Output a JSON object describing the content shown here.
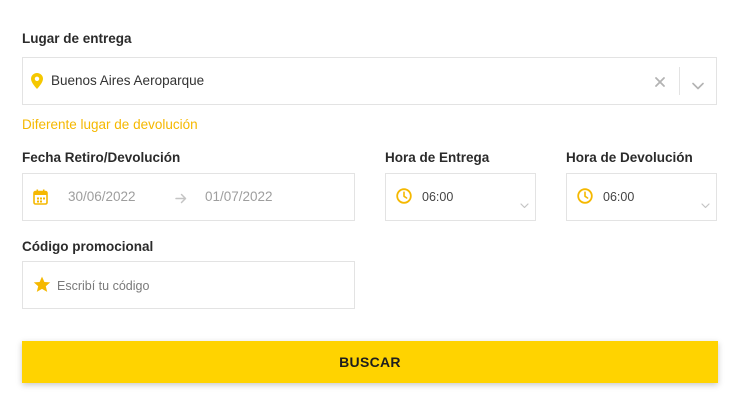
{
  "pickup": {
    "label": "Lugar de entrega",
    "value": "Buenos Aires Aeroparque",
    "different_return_link": "Diferente lugar de devolución"
  },
  "dates": {
    "label": "Fecha Retiro/Devolución",
    "start": "30/06/2022",
    "end": "01/07/2022"
  },
  "pickup_time": {
    "label": "Hora de Entrega",
    "value": "06:00"
  },
  "return_time": {
    "label": "Hora de Devolución",
    "value": "06:00"
  },
  "promo": {
    "label": "Código promocional",
    "placeholder": "Escribí tu código"
  },
  "search_button": "BUSCAR",
  "colors": {
    "accent": "#ffd300",
    "icon": "#f5b800",
    "border": "#e3e3e3"
  },
  "icons": [
    "location-pin-icon",
    "clear-icon",
    "chevron-down-icon",
    "calendar-icon",
    "arrow-right-icon",
    "clock-icon",
    "star-icon"
  ]
}
